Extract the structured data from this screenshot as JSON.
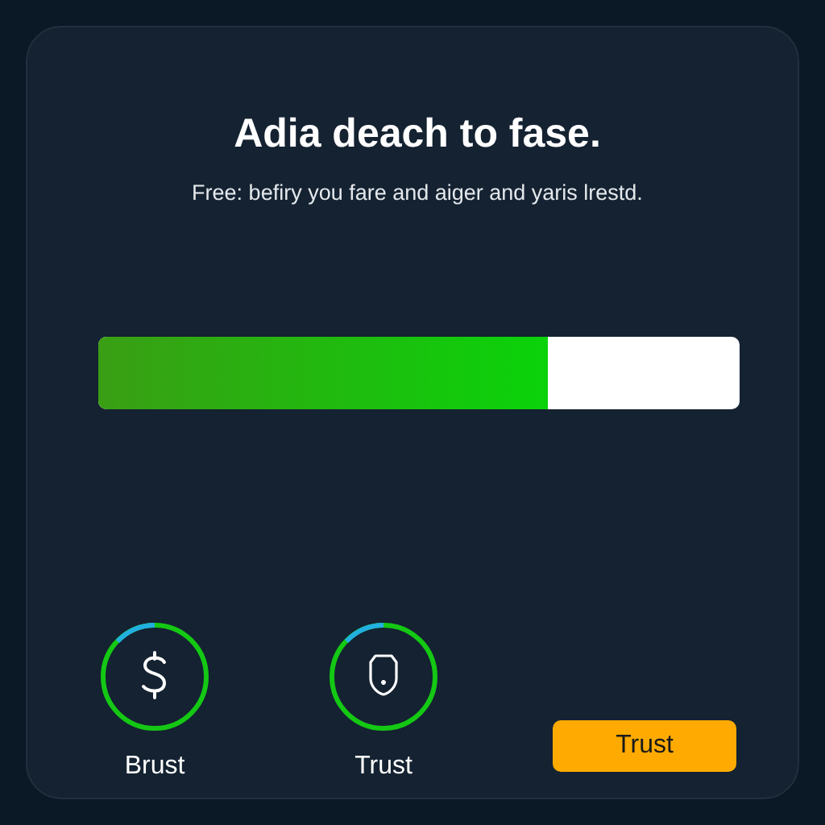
{
  "title": "Adia deach to fase.",
  "subtitle": "Free: befiry you fare and aiger and yaris lrestd.",
  "progress": {
    "level": 0.7
  },
  "items": [
    {
      "kind": "dollar",
      "label": "Brust"
    },
    {
      "kind": "shield",
      "label": "Trust"
    }
  ],
  "button": {
    "label": "Trust"
  }
}
